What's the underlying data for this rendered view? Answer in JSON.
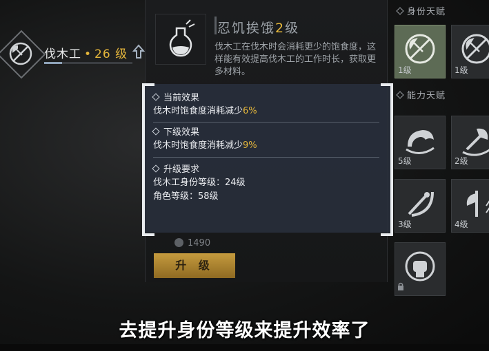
{
  "identity": {
    "job_name": "伐木工",
    "separator": "•",
    "level_text": "26 级",
    "icon": "axe-forbidden-icon"
  },
  "talent": {
    "name_prefix": "忍饥挨饿",
    "name_num": "2",
    "name_suffix": "级",
    "icon": "potion-flask-icon",
    "description": "伐木工在伐木时会消耗更少的饱食度，这样能有效提高伐木工的工作时长，获取更多材料。"
  },
  "popup": {
    "current": {
      "title": "当前效果",
      "text": "伐木时饱食度消耗减少",
      "value": "6%"
    },
    "next": {
      "title": "下级效果",
      "text": "伐木时饱食度消耗减少",
      "value": "9%"
    },
    "requirements": {
      "title": "升级要求",
      "line1": "伐木工身份等级：24级",
      "line2": "角色等级：58级"
    }
  },
  "cost": {
    "amount": "1490",
    "icon": "coin-icon"
  },
  "upgrade_button": "升 级",
  "sidebar": {
    "identity_talent_label": "身份天赋",
    "ability_talent_label": "能力天赋",
    "slots": [
      {
        "level": "1级",
        "icon": "axe-crossed-icon"
      },
      {
        "level": "1级",
        "icon": "axe-crossed-icon"
      },
      {
        "level": "5级",
        "icon": "strength-arm-icon"
      },
      {
        "level": "2级",
        "icon": "axe-icon"
      },
      {
        "level": "3级",
        "icon": "slash-icon"
      },
      {
        "level": "4级",
        "icon": "axe-up-icon"
      },
      {
        "level": "",
        "icon": "fist-icon"
      }
    ]
  },
  "subtitle": "去提升身份等级来提升效率了",
  "colors": {
    "accent": "#e4b63b",
    "popup_bg": "#282e3a",
    "slot_lit": "#5d6b55"
  }
}
